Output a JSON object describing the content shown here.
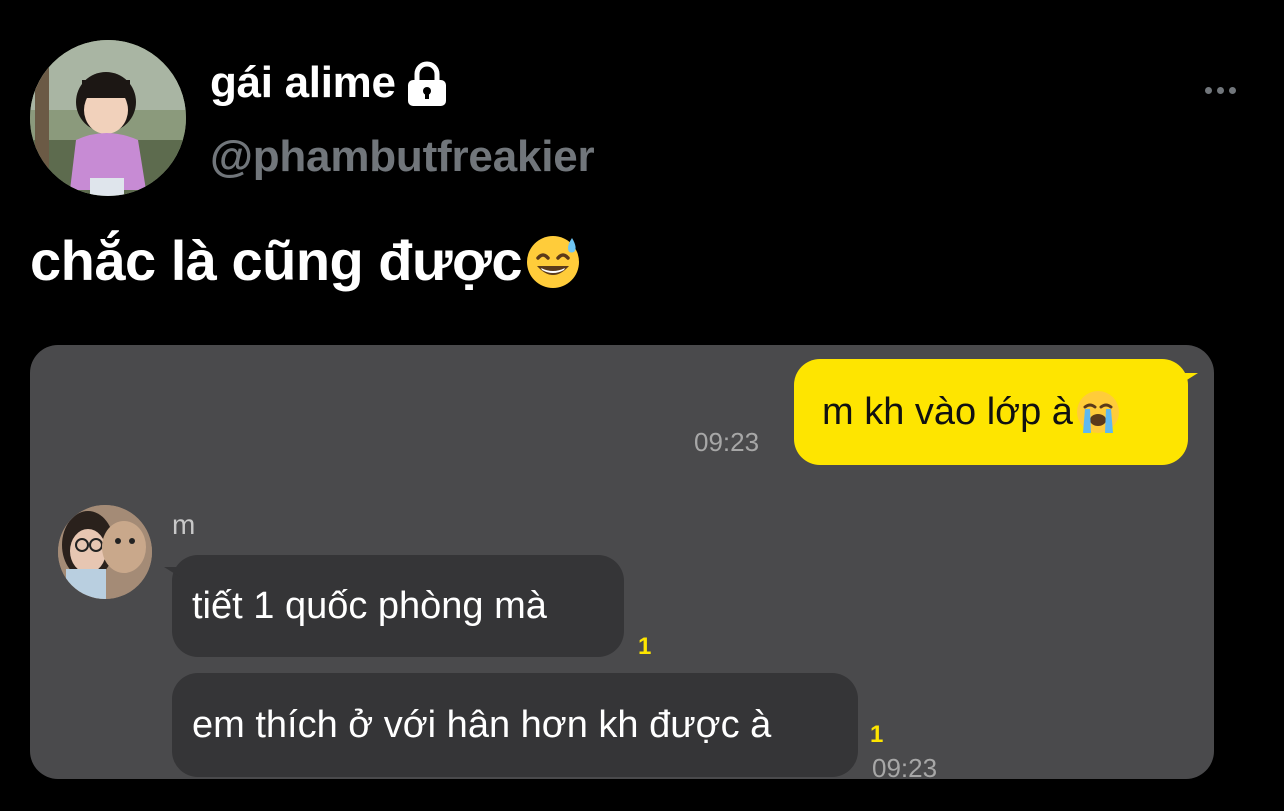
{
  "tweet": {
    "display_name": "gái alime",
    "handle": "@phambutfreakier",
    "text": "chắc là cũng được",
    "text_emoji": "sweat-smile-emoji",
    "more_icon": "more-horizontal-icon",
    "lock_icon": "lock-icon"
  },
  "chat": {
    "outgoing": {
      "text": "m kh vào lớp à",
      "emoji": "loudly-crying-emoji",
      "time": "09:23"
    },
    "sender_name": "m",
    "incoming": [
      {
        "text": "tiết 1 quốc phòng mà",
        "unread": "1"
      },
      {
        "text": "em thích ở với hân hơn kh được à",
        "unread": "1",
        "time": "09:23"
      }
    ]
  },
  "colors": {
    "background": "#000000",
    "handle": "#71767b",
    "card": "#4a4a4c",
    "outgoing_bubble": "#fee500",
    "incoming_bubble": "#353537",
    "unread": "#fee500"
  }
}
